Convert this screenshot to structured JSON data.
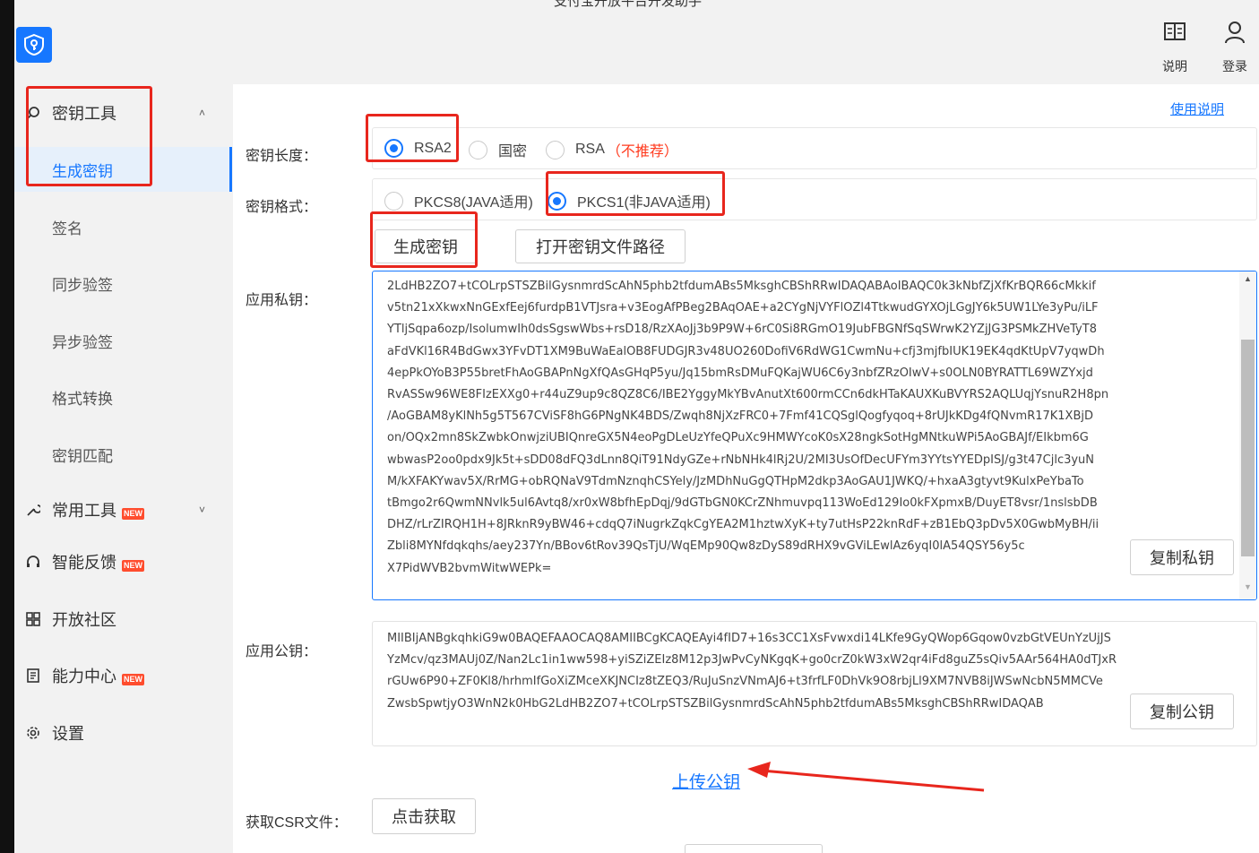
{
  "window": {
    "title": "支付宝开放平台开发助手"
  },
  "header": {
    "actions": [
      {
        "label": "说明",
        "icon": "book-icon"
      },
      {
        "label": "登录",
        "icon": "user-icon"
      }
    ]
  },
  "sidebar": {
    "groups": [
      {
        "label": "密钥工具",
        "icon": "search-icon",
        "expanded": true,
        "badge": ""
      },
      {
        "label": "常用工具",
        "icon": "wrench-icon",
        "expanded": false,
        "badge": "NEW"
      },
      {
        "label": "智能反馈",
        "icon": "headset-icon",
        "badge": "NEW"
      },
      {
        "label": "开放社区",
        "icon": "grid-icon",
        "badge": ""
      },
      {
        "label": "能力中心",
        "icon": "capability-icon",
        "badge": "NEW"
      },
      {
        "label": "设置",
        "icon": "gear-icon",
        "badge": ""
      }
    ],
    "key_items": [
      {
        "label": "生成密钥",
        "active": true
      },
      {
        "label": "签名",
        "active": false
      },
      {
        "label": "同步验签",
        "active": false
      },
      {
        "label": "异步验签",
        "active": false
      },
      {
        "label": "格式转换",
        "active": false
      },
      {
        "label": "密钥匹配",
        "active": false
      }
    ]
  },
  "main": {
    "usage_link": "使用说明",
    "key_length": {
      "label": "密钥长度：",
      "options": [
        {
          "label": "RSA2",
          "selected": true
        },
        {
          "label": "国密",
          "selected": false
        },
        {
          "label": "RSA",
          "selected": false,
          "note": "（不推荐）"
        }
      ]
    },
    "key_format": {
      "label": "密钥格式：",
      "options": [
        {
          "label": "PKCS8(JAVA适用)",
          "selected": false
        },
        {
          "label": "PKCS1(非JAVA适用)",
          "selected": true
        }
      ]
    },
    "generate_button": "生成密钥",
    "open_path_button": "打开密钥文件路径",
    "private_key": {
      "label": "应用私钥：",
      "copy_button": "复制私钥",
      "lines": [
        "2LdHB2ZO7+tCOLrpSTSZBilGysnmrdScAhN5phb2tfdumABs5MksghCBShRRwIDAQABAoIBAQC0k3kNbfZjXfKrBQR66cMkkif",
        "v5tn21xXkwxNnGExfEej6furdpB1VTJsra+v3EogAfPBeg2BAqOAE+a2CYgNjVYFlOZl4TtkwudGYXOjLGgJY6k5UW1LYe3yPu/iLF",
        "YTljSqpa6ozp/IsolumwIh0dsSgswWbs+rsD18/RzXAoJj3b9P9W+6rC0Si8RGmO19JubFBGNfSqSWrwK2YZjJG3PSMkZHVeTyT8",
        "aFdVKl16R4BdGwx3YFvDT1XM9BuWaEalOB8FUDGJR3v48UO260DofiV6RdWG1CwmNu+cfj3mjfbIUK19EK4qdKtUpV7yqwDh",
        "4epPkOYoB3P55bretFhAoGBAPnNgXfQAsGHqP5yu/Jq15bmRsDMuFQKajWU6C6y3nbfZRzOIwV+s0OLN0BYRATTL69WZYxjd",
        "RvASSw96WE8FIzEXXg0+r44uZ9up9c8QZ8C6/IBE2YggyMkYBvAnutXt600rmCCn6dkHTaKAUXKuBVYRS2AQLUqjYsnuR2H8pn",
        "/AoGBAM8yKlNh5g5T567CViSF8hG6PNgNK4BDS/Zwqh8NjXzFRC0+7Fmf41CQSglQogfyqoq+8rUJkKDg4fQNvmR17K1XBjD",
        "on/OQx2mn8SkZwbkOnwjziUBIQnreGX5N4eoPgDLeUzYfeQPuXc9HMWYcoK0sX28ngkSotHgMNtkuWPi5AoGBAJf/EIkbm6G",
        "wbwasP2oo0pdx9Jk5t+sDD08dFQ3dLnn8QiT91NdyGZe+rNbNHk4lRj2U/2MI3UsOfDecUFYm3YYtsYYEDpISJ/g3t47Cjlc3yuN",
        "M/kXFAKYwav5X/RrMG+obRQNaV9TdmNznqhCSYely/JzMDhNuGgQTHpM2dkp3AoGAU1JWKQ/+hxaA3gtyvt9KulxPeYbaTo",
        "tBmgo2r6QwmNNvlk5ul6Avtq8/xr0xW8bfhEpDqj/9dGTbGN0KCrZNhmuvpq113WoEd129Io0kFXpmxB/DuyET8vsr/1nslsbDB",
        "DHZ/rLrZIRQH1H+8JRknR9yBW46+cdqQ7iNugrkZqkCgYEA2M1hztwXyK+ty7utHsP22knRdF+zB1EbQ3pDv5X0GwbMyBH/ii",
        "Zbli8MYNfdqkqhs/aey237Yn/BBov6tRov39QsTjU/WqEMp90Qw8zDyS89dRHX9vGViLEwlAz6yqI0lA54QSY56y5c",
        "X7PidWVB2bvmWitwWEPk="
      ]
    },
    "public_key": {
      "label": "应用公钥：",
      "copy_button": "复制公钥",
      "lines": [
        "MIIBIjANBgkqhkiG9w0BAQEFAAOCAQ8AMIIBCgKCAQEAyi4fID7+16s3CC1XsFvwxdi14LKfe9GyQWop6Gqow0vzbGtVEUnYzUjJS",
        "YzMcv/qz3MAUj0Z/Nan2Lc1in1ww598+yiSZiZEIz8M12p3JwPvCyNKgqK+go0crZ0kW3xW2qr4iFd8guZ5sQiv5AAr564HA0dTJxR",
        "rGUw6P90+ZF0Kl8/hrhmIfGoXiZMceXKJNCIz8tZEQ3/RuJuSnzVNmAJ6+t3frfLF0DhVk9O8rbjLl9XM7NVB8iJWSwNcbN5MMCVe",
        "ZwsbSpwtjyO3WnN2k0HbG2LdHB2ZO7+tCOLrpSTSZBilGysnmrdScAhN5phb2tfdumABs5MksghCBShRRwIDAQAB"
      ]
    },
    "upload_link": "上传公钥",
    "csr": {
      "label": "获取CSR文件：",
      "button": "点击获取"
    }
  }
}
